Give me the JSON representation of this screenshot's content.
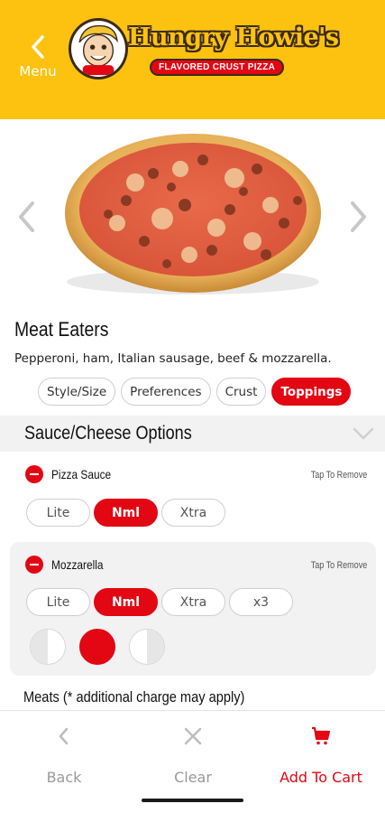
{
  "header": {
    "back_label": "Menu",
    "brand_name": "Hungry Howie's",
    "brand_tagline": "FLAVORED CRUST PIZZA"
  },
  "product": {
    "name": "Meat Eaters",
    "description": "Pepperoni, ham, Italian sausage, beef & mozzarella."
  },
  "tabs": [
    {
      "label": "Style/Size",
      "active": false
    },
    {
      "label": "Preferences",
      "active": false
    },
    {
      "label": "Crust",
      "active": false
    },
    {
      "label": "Toppings",
      "active": true
    }
  ],
  "section": {
    "title": "Sauce/Cheese Options",
    "next_section_peek": "Meats (* additional charge may apply)"
  },
  "options": [
    {
      "name": "Pizza Sauce",
      "hint": "Tap To Remove",
      "amounts": [
        "Lite",
        "Nml",
        "Xtra"
      ],
      "selected": "Nml"
    },
    {
      "name": "Mozzarella",
      "hint": "Tap To Remove",
      "amounts": [
        "Lite",
        "Nml",
        "Xtra",
        "x3"
      ],
      "selected": "Nml",
      "coverage": [
        "left-half",
        "whole",
        "right-half"
      ],
      "coverage_selected": "whole"
    }
  ],
  "bottom_bar": {
    "back_label": "Back",
    "clear_label": "Clear",
    "add_label": "Add To Cart"
  },
  "colors": {
    "brand_yellow": "#fdc20f",
    "accent_red": "#e30613"
  }
}
